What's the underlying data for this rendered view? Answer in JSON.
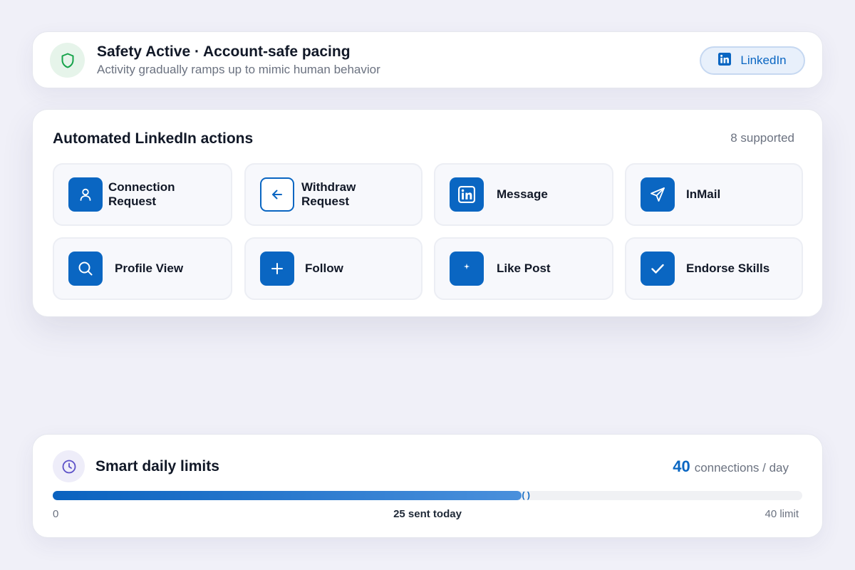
{
  "header": {
    "title": "Safety Active · Account-safe pacing",
    "subtitle": "Activity gradually ramps up to mimic human behavior",
    "platform_label": "LinkedIn",
    "icon": "shield-icon",
    "platform_icon": "linkedin-icon"
  },
  "actions": {
    "title": "Automated LinkedIn actions",
    "count_label": "8 supported",
    "items": [
      {
        "label": "Connection Request",
        "icon": "user-icon"
      },
      {
        "label": "Withdraw Request",
        "icon": "arrow-left-icon"
      },
      {
        "label": "Message",
        "icon": "linkedin-icon"
      },
      {
        "label": "InMail",
        "icon": "send-icon"
      },
      {
        "label": "Profile View",
        "icon": "search-icon"
      },
      {
        "label": "Follow",
        "icon": "plus-icon"
      },
      {
        "label": "Like Post",
        "icon": "sparkle-icon"
      },
      {
        "label": "Endorse Skills",
        "icon": "check-icon"
      }
    ]
  },
  "limits": {
    "title": "Smart daily limits",
    "value": "40",
    "unit": "connections / day",
    "sent": 25,
    "max": 40,
    "min_label": "0",
    "sent_label": "25 sent today",
    "max_label": "40 limit",
    "knob_label": "( )",
    "icon": "clock-icon"
  },
  "colors": {
    "brand": "#0a66c2",
    "safe_green": "#16a34a",
    "clock_purple": "#5b50c8",
    "background": "#f0f0f8"
  }
}
